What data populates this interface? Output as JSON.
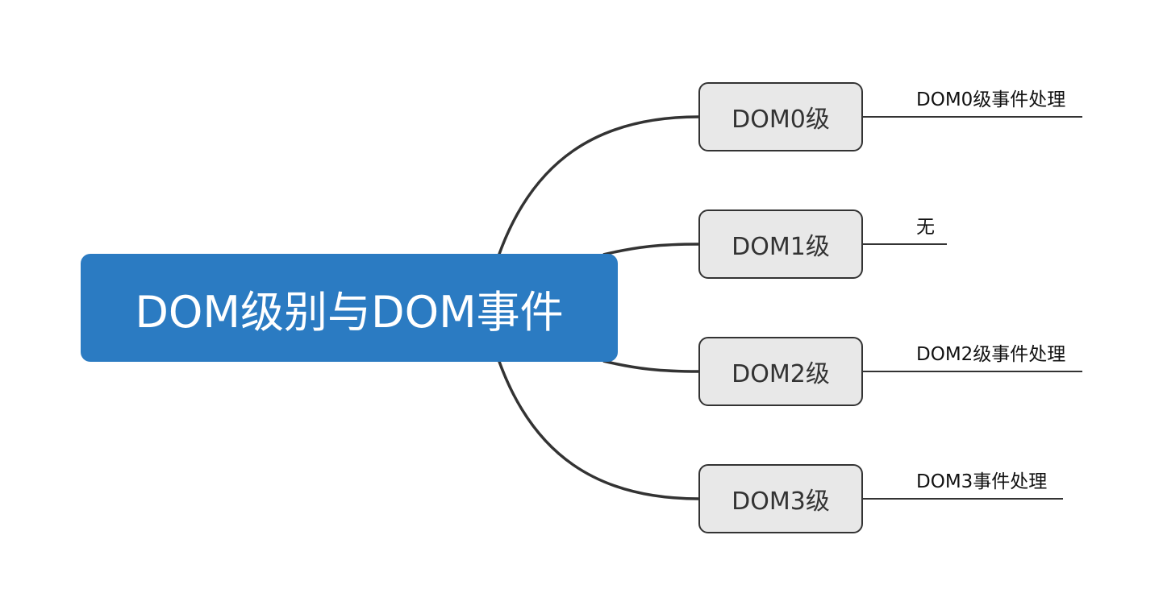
{
  "root": {
    "label": "DOM级别与DOM事件",
    "color": "#2b7bc2"
  },
  "branches": [
    {
      "label": "DOM0级",
      "leaf": "DOM0级事件处理"
    },
    {
      "label": "DOM1级",
      "leaf": "无"
    },
    {
      "label": "DOM2级",
      "leaf": "DOM2级事件处理"
    },
    {
      "label": "DOM3级",
      "leaf": "DOM3事件处理"
    }
  ],
  "colors": {
    "branch_fill": "#e8e8e8",
    "line": "#333333"
  }
}
